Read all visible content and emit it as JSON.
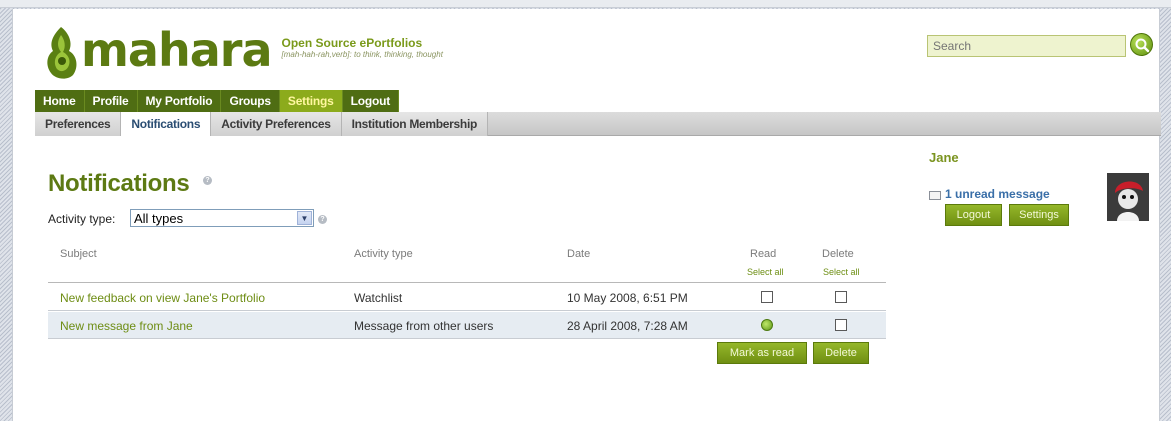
{
  "brand": {
    "name": "mahara",
    "tagline": "Open Source ePortfolios",
    "subtagline": "[mah-hah-rah,verb]: to think, thinking, thought"
  },
  "search": {
    "placeholder": "Search"
  },
  "main_nav": [
    {
      "label": "Home",
      "active": false
    },
    {
      "label": "Profile",
      "active": false
    },
    {
      "label": "My Portfolio",
      "active": false
    },
    {
      "label": "Groups",
      "active": false
    },
    {
      "label": "Settings",
      "active": true
    },
    {
      "label": "Logout",
      "active": false
    }
  ],
  "sub_nav": [
    {
      "label": "Preferences",
      "active": false
    },
    {
      "label": "Notifications",
      "active": true
    },
    {
      "label": "Activity Preferences",
      "active": false
    },
    {
      "label": "Institution Membership",
      "active": false
    }
  ],
  "page": {
    "title": "Notifications",
    "activity_type_label": "Activity type:",
    "activity_type_value": "All types"
  },
  "table": {
    "headers": {
      "subject": "Subject",
      "activity_type": "Activity type",
      "date": "Date",
      "read": "Read",
      "delete": "Delete",
      "select_all": "Select all"
    },
    "rows": [
      {
        "subject": "New feedback on view Jane's Portfolio",
        "activity_type": "Watchlist",
        "date": "10 May 2008, 6:51 PM",
        "read": false,
        "delete": false
      },
      {
        "subject": "New message from Jane",
        "activity_type": "Message from other users",
        "date": "28 April 2008, 7:28 AM",
        "read": true,
        "delete": false
      }
    ],
    "mark_as_read_label": "Mark as read",
    "delete_label": "Delete"
  },
  "sidebar": {
    "user_name": "Jane",
    "unread_messages": "1 unread message",
    "logout_label": "Logout",
    "settings_label": "Settings"
  },
  "colors": {
    "brand_green": "#5d7a13",
    "nav_dark": "#4f6d13",
    "nav_active": "#8cab1c",
    "link_blue": "#3a6fa8"
  }
}
